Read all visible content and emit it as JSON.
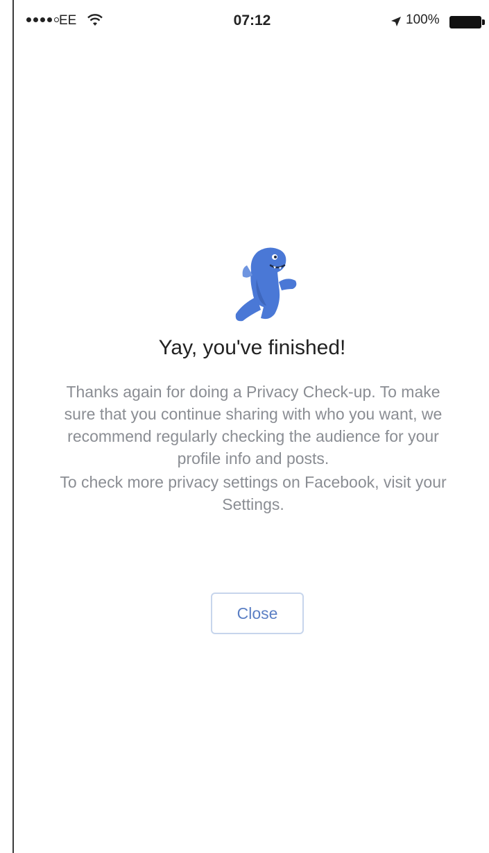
{
  "status_bar": {
    "carrier": "EE",
    "time": "07:12",
    "battery": "100%"
  },
  "content": {
    "title": "Yay, you've finished!",
    "paragraph1": "Thanks again for doing a Privacy Check-up. To make sure that you continue sharing with who you want, we recommend regularly checking the audience for your profile info and posts.",
    "paragraph2": "To check more privacy settings on Facebook, visit your Settings.",
    "close_label": "Close"
  },
  "colors": {
    "mascot": "#4a78d6",
    "button_text": "#5b7fc4",
    "body_text": "#8a8d93"
  },
  "icons": {
    "mascot": "dinosaur-mascot-icon",
    "wifi": "wifi-icon",
    "location": "location-arrow-icon",
    "battery": "battery-icon"
  }
}
